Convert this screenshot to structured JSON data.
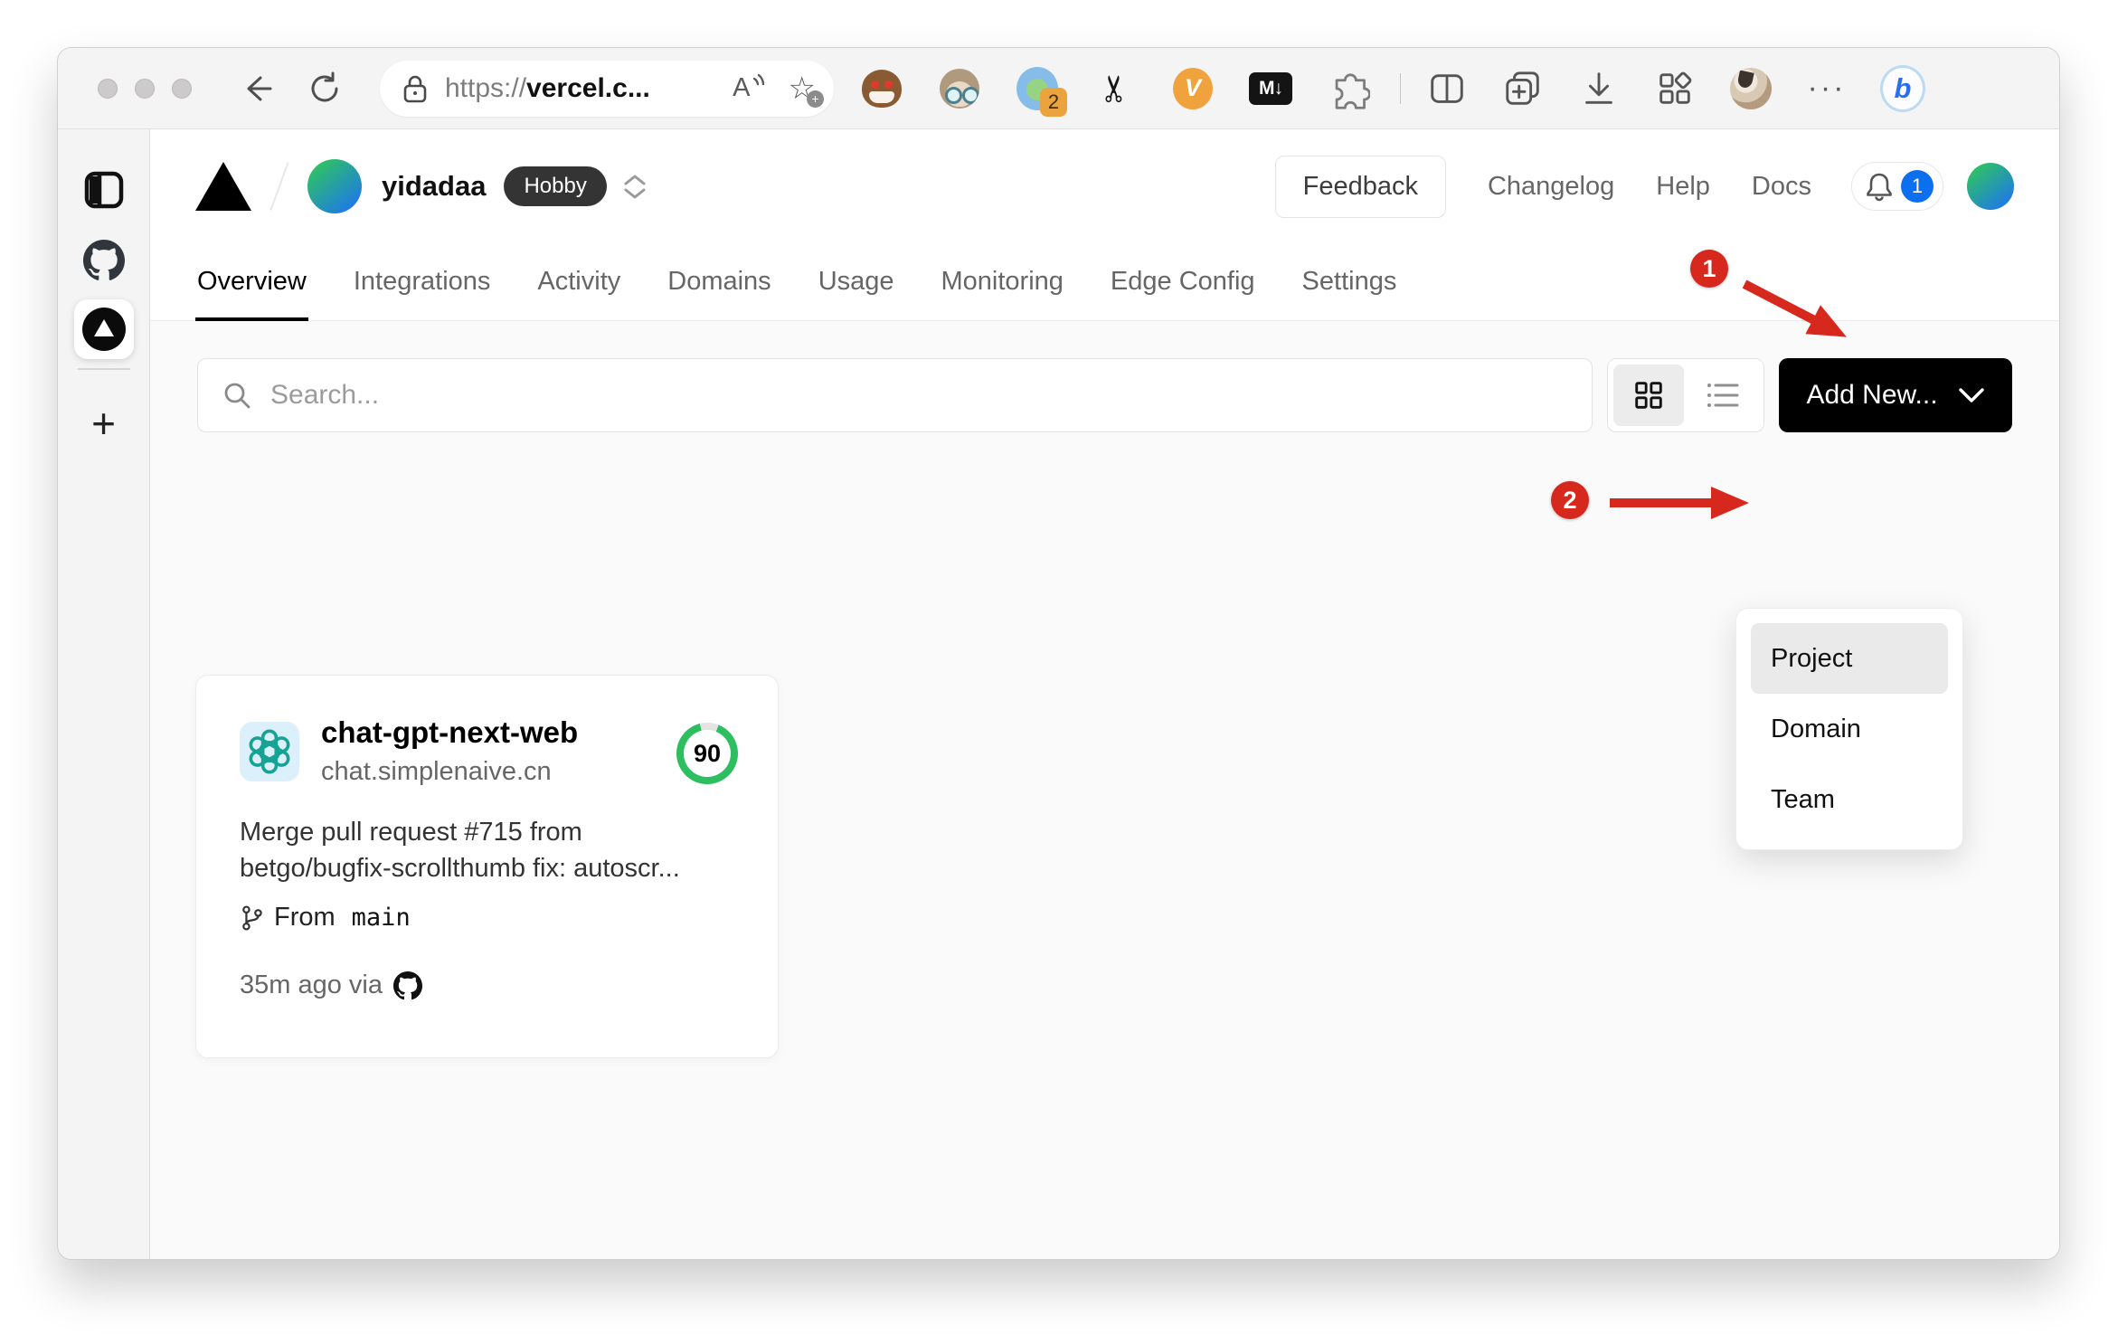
{
  "colors": {
    "accent_red": "#d7281d",
    "score_green": "#2dbe60",
    "notification_blue": "#0b6ff0",
    "openai_teal": "#17a394",
    "button_black": "#000000",
    "body_gray": "#fafafa"
  },
  "browser": {
    "url_scheme": "https://",
    "url_host": "vercel.c...",
    "extension_badge_count": "2",
    "markdown_icon_label": "M↓",
    "v_extension_label": "V",
    "bing_label": "b",
    "overflow_label": "···",
    "read_aloud_label": "A"
  },
  "vercel_header": {
    "team_name": "yidadaa",
    "plan_badge": "Hobby",
    "feedback_button": "Feedback",
    "links": [
      {
        "label": "Changelog"
      },
      {
        "label": "Help"
      },
      {
        "label": "Docs"
      }
    ],
    "notification_count": "1"
  },
  "tabs": [
    {
      "label": "Overview",
      "active": true
    },
    {
      "label": "Integrations",
      "active": false
    },
    {
      "label": "Activity",
      "active": false
    },
    {
      "label": "Domains",
      "active": false
    },
    {
      "label": "Usage",
      "active": false
    },
    {
      "label": "Monitoring",
      "active": false
    },
    {
      "label": "Edge Config",
      "active": false
    },
    {
      "label": "Settings",
      "active": false
    }
  ],
  "controls": {
    "search_placeholder": "Search...",
    "add_new_label": "Add New..."
  },
  "dropdown": {
    "items": [
      {
        "label": "Project",
        "highlighted": true
      },
      {
        "label": "Domain",
        "highlighted": false
      },
      {
        "label": "Team",
        "highlighted": false
      }
    ]
  },
  "project_card": {
    "name": "chat-gpt-next-web",
    "domain": "chat.simplenaive.cn",
    "score": "90",
    "commit_line1": "Merge pull request #715 from",
    "commit_line2": "betgo/bugfix-scrollthumb fix: autoscr...",
    "from_label": "From",
    "branch": "main",
    "time_ago": "35m ago via"
  },
  "annotations": {
    "step1": "1",
    "step2": "2"
  }
}
